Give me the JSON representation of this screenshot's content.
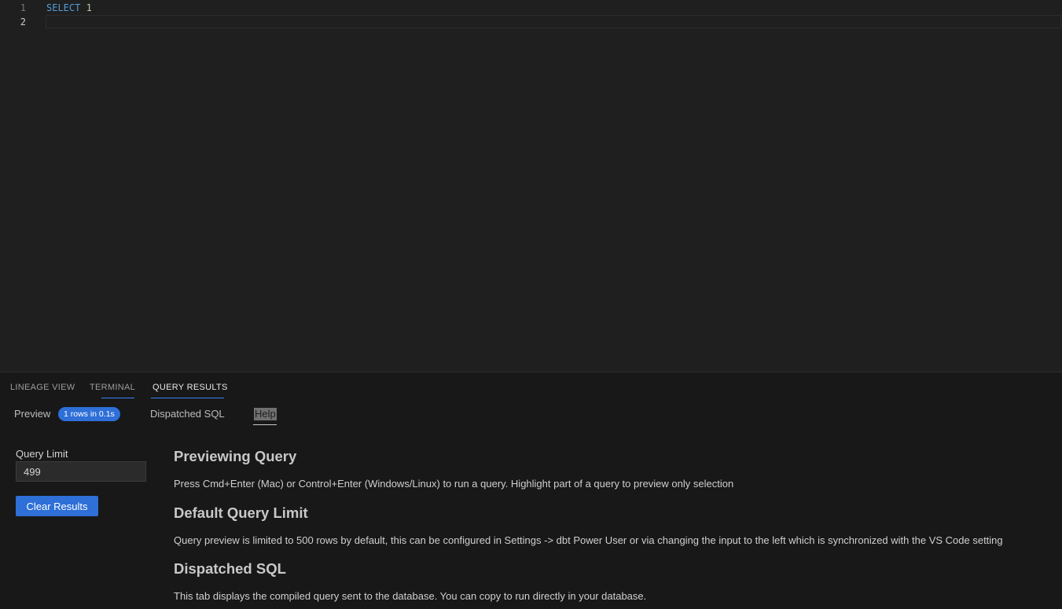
{
  "editor": {
    "lines": [
      {
        "number": "1",
        "keyword": "SELECT",
        "rest": " 1"
      },
      {
        "number": "2",
        "keyword": "",
        "rest": ""
      }
    ]
  },
  "panel": {
    "tabs": [
      {
        "label": "LINEAGE VIEW",
        "active": false
      },
      {
        "label": "TERMINAL",
        "active": false
      },
      {
        "label": "QUERY RESULTS",
        "active": true
      }
    ],
    "subtabs": {
      "preview": "Preview",
      "preview_badge": "1 rows in 0.1s",
      "dispatched_sql": "Dispatched SQL",
      "help": "Help"
    },
    "query_limit": {
      "label": "Query Limit",
      "value": "499"
    },
    "clear_button": "Clear Results",
    "help": {
      "sections": [
        {
          "title": "Previewing Query",
          "body": "Press Cmd+Enter (Mac) or Control+Enter (Windows/Linux) to run a query. Highlight part of a query to preview only selection"
        },
        {
          "title": "Default Query Limit",
          "body": "Query preview is limited to 500 rows by default, this can be configured in Settings -> dbt Power User or via changing the input to the left which is synchronized with the VS Code setting"
        },
        {
          "title": "Dispatched SQL",
          "body": "This tab displays the compiled query sent to the database. You can copy to run directly in your database."
        }
      ]
    }
  },
  "colors": {
    "accent": "#2e6fd8",
    "tab_underline": "#3b82f6",
    "keyword": "#569cd6",
    "number": "#b5cea8"
  }
}
